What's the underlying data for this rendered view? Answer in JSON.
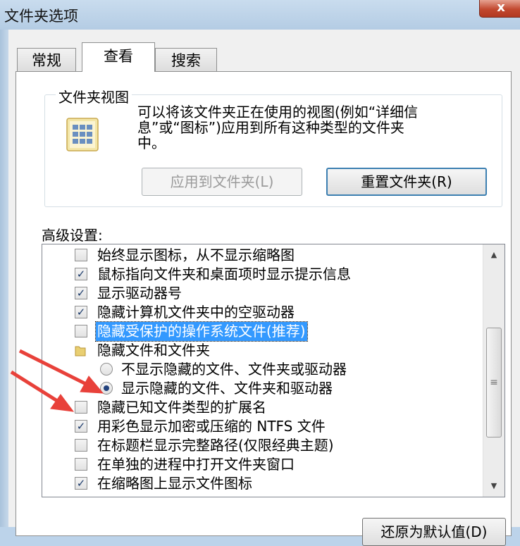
{
  "window": {
    "title": "文件夹选项",
    "close_glyph": "x"
  },
  "tabs": [
    {
      "label": "常规",
      "active": false
    },
    {
      "label": "查看",
      "active": true
    },
    {
      "label": "搜索",
      "active": false
    }
  ],
  "folder_view": {
    "legend": "文件夹视图",
    "description": "可以将该文件夹正在使用的视图(例如“详细信\n息”或“图标”)应用到所有这种类型的文件夹\n中。",
    "icon": "folder-view-icon",
    "apply_button": "应用到文件夹(L)",
    "reset_button": "重置文件夹(R)"
  },
  "advanced": {
    "label": "高级设置:",
    "items": [
      {
        "type": "checkbox",
        "checked": false,
        "label": "始终显示图标，从不显示缩略图"
      },
      {
        "type": "checkbox",
        "checked": true,
        "label": "鼠标指向文件夹和桌面项时显示提示信息"
      },
      {
        "type": "checkbox",
        "checked": true,
        "label": "显示驱动器号"
      },
      {
        "type": "checkbox",
        "checked": true,
        "label": "隐藏计算机文件夹中的空驱动器"
      },
      {
        "type": "checkbox",
        "checked": false,
        "label": "隐藏受保护的操作系统文件(推荐)",
        "selected": true
      },
      {
        "type": "folder",
        "label": "隐藏文件和文件夹"
      },
      {
        "type": "radio",
        "checked": false,
        "label": "不显示隐藏的文件、文件夹或驱动器"
      },
      {
        "type": "radio",
        "checked": true,
        "label": "显示隐藏的文件、文件夹和驱动器"
      },
      {
        "type": "checkbox",
        "checked": false,
        "label": "隐藏已知文件类型的扩展名"
      },
      {
        "type": "checkbox",
        "checked": true,
        "label": "用彩色显示加密或压缩的 NTFS 文件"
      },
      {
        "type": "checkbox",
        "checked": false,
        "label": "在标题栏显示完整路径(仅限经典主题)"
      },
      {
        "type": "checkbox",
        "checked": false,
        "label": "在单独的进程中打开文件夹窗口"
      },
      {
        "type": "checkbox",
        "checked": true,
        "label": "在缩略图上显示文件图标"
      }
    ]
  },
  "restore_defaults_button": "还原为默认值(D)",
  "colors": {
    "selection": "#3399ff",
    "annotation_arrow": "#e8413a"
  }
}
